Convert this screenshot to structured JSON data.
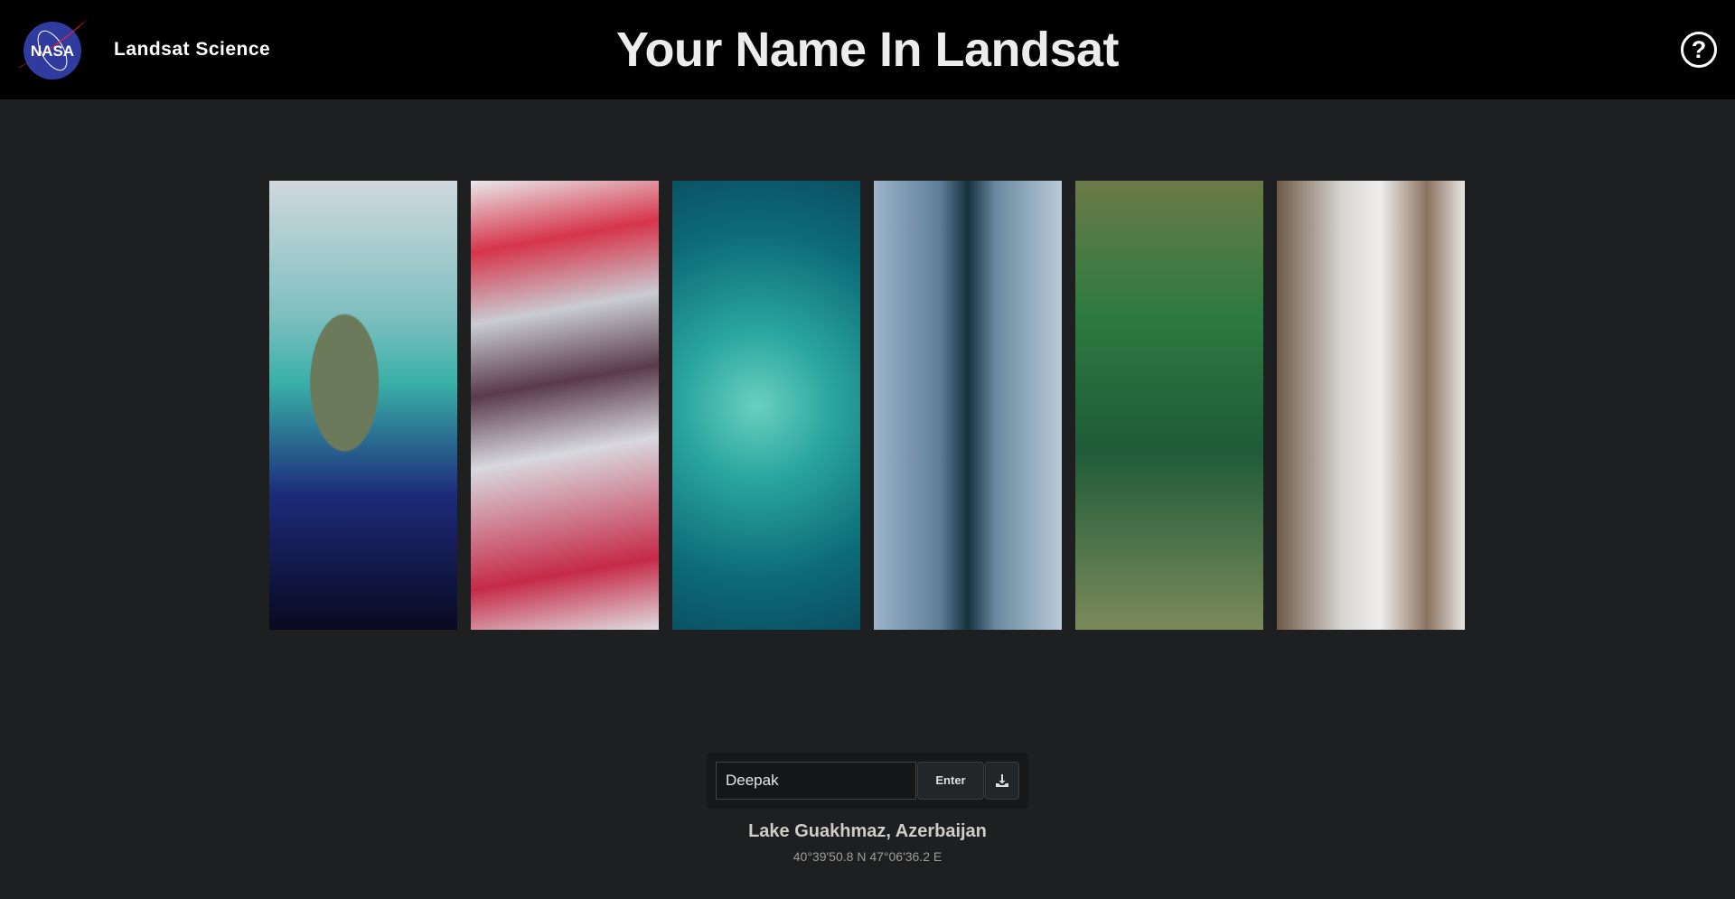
{
  "header": {
    "brand": "Landsat Science",
    "title": "Your Name In Landsat",
    "logo_text": "NASA",
    "help_icon": "question-circle-icon"
  },
  "tiles": [
    "tile-1",
    "tile-2",
    "tile-3",
    "tile-4",
    "tile-5",
    "tile-6"
  ],
  "form": {
    "name_value": "Deepak",
    "enter_label": "Enter",
    "download_icon": "download-icon"
  },
  "location": {
    "name": "Lake Guakhmaz, Azerbaijan",
    "coordinates": "40°39'50.8 N 47°06'36.2 E"
  },
  "colors": {
    "header_bg": "#000000",
    "page_bg": "#1e1f21",
    "nasa_blue": "#2f3b9e",
    "nasa_red": "#e8202f"
  }
}
